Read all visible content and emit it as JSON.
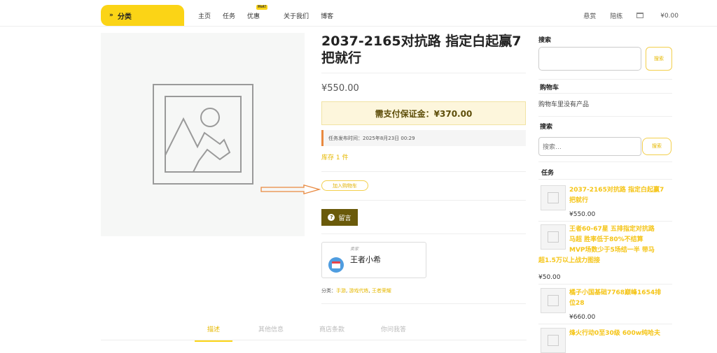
{
  "header": {
    "category_label": "分类",
    "nav": [
      "主页",
      "任务",
      "优惠",
      "关于我们",
      "博客"
    ],
    "hot_badge": "Hot!",
    "right": [
      "悬赏",
      "陪练"
    ],
    "cart_total": "¥0.00"
  },
  "product": {
    "title": "2037-2165对抗路 指定白起赢7把就行",
    "price": "¥550.00",
    "deposit": "需支付保证金：¥370.00",
    "publish_time": "任务发布时间：2025年8月23日 00:29",
    "stock": "库存 1 件",
    "add_to_cart": "加入购物车",
    "message_button": "留言",
    "store_tag": "卖家",
    "store_name": "王者小希",
    "categories_label": "分类：",
    "categories": [
      "手游",
      "游戏代练",
      "王者荣耀"
    ]
  },
  "tabs": [
    "描述",
    "其他信息",
    "商店条款",
    "你问我答"
  ],
  "sidebar": {
    "search_heading": "搜索",
    "search_button": "搜索",
    "cart_heading": "购物车",
    "cart_empty": "购物车里没有产品",
    "search2_heading": "搜索",
    "search2_placeholder": "搜索…",
    "search2_button": "搜索",
    "tasks_heading": "任务",
    "tasks": [
      {
        "title_lines": [
          "2037-2165对抗路 指定白起赢7",
          "把就行"
        ],
        "price": "¥550.00"
      },
      {
        "title_lines": [
          "王者60-67星 五排指定对抗路",
          "马超 胜率低于80%不结算",
          "MVP场数少于5场结一半 带马",
          "超1.5万以上战力图接"
        ],
        "price": "¥50.00"
      },
      {
        "title_lines": [
          "橘子小国基础7768巅峰1654排",
          "位28"
        ],
        "price": "¥660.00"
      },
      {
        "title_lines": [
          "烽火行动0至30级 600w纯哈夫"
        ],
        "price": ""
      }
    ]
  },
  "colors": {
    "accent": "#fbd416",
    "link": "#e6b800",
    "message_button": "#6a5a0a",
    "arrow": "#e9893f"
  }
}
